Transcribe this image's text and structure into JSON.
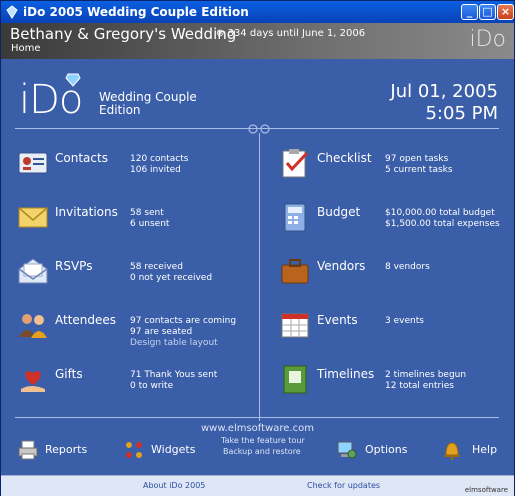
{
  "window": {
    "title": "iDo 2005 Wedding Couple Edition"
  },
  "header": {
    "wedding_title": "Bethany & Gregory's Wedding",
    "countdown": "334 days until June 1, 2006",
    "breadcrumb": "Home",
    "logo": "iDo"
  },
  "brand": {
    "logo": "iDo",
    "line1": "Wedding Couple",
    "line2": "Edition"
  },
  "datetime": {
    "date": "Jul 01, 2005",
    "time": "5:05 PM"
  },
  "left_items": [
    {
      "name": "Contacts",
      "l1": "120 contacts",
      "l2": "106 invited",
      "icon": "contacts-card-icon"
    },
    {
      "name": "Invitations",
      "l1": "58 sent",
      "l2": "6 unsent",
      "icon": "envelope-icon"
    },
    {
      "name": "RSVPs",
      "l1": "58 received",
      "l2": "0 not yet received",
      "icon": "open-envelope-icon"
    },
    {
      "name": "Attendees",
      "l1": "97 contacts are coming",
      "l2": "97 are seated",
      "l3": "Design table layout",
      "icon": "people-icon"
    },
    {
      "name": "Gifts",
      "l1": "71 Thank Yous sent",
      "l2": "0 to write",
      "icon": "heart-hand-icon"
    }
  ],
  "right_items": [
    {
      "name": "Checklist",
      "l1": "97 open tasks",
      "l2": "5 current tasks",
      "icon": "checklist-icon"
    },
    {
      "name": "Budget",
      "l1": "$10,000.00 total budget",
      "l2": "$1,500.00 total expenses",
      "icon": "calculator-icon"
    },
    {
      "name": "Vendors",
      "l1": "8 vendors",
      "icon": "briefcase-icon"
    },
    {
      "name": "Events",
      "l1": "3 events",
      "icon": "calendar-icon"
    },
    {
      "name": "Timelines",
      "l1": "2 timelines begun",
      "l2": "12 total entries",
      "icon": "timeline-book-icon"
    }
  ],
  "links": {
    "website": "www.elmsoftware.com",
    "tour": "Take the feature tour",
    "backup": "Backup and restore"
  },
  "toolbar": {
    "reports": "Reports",
    "widgets": "Widgets",
    "options": "Options",
    "help": "Help"
  },
  "footer": {
    "about": "About iDo 2005",
    "updates": "Check for updates",
    "vendor": "elmsoftware"
  },
  "colors": {
    "background": "#3b5ea8",
    "titlebar": "#0a5fe0",
    "divider": "#a9bde6"
  }
}
